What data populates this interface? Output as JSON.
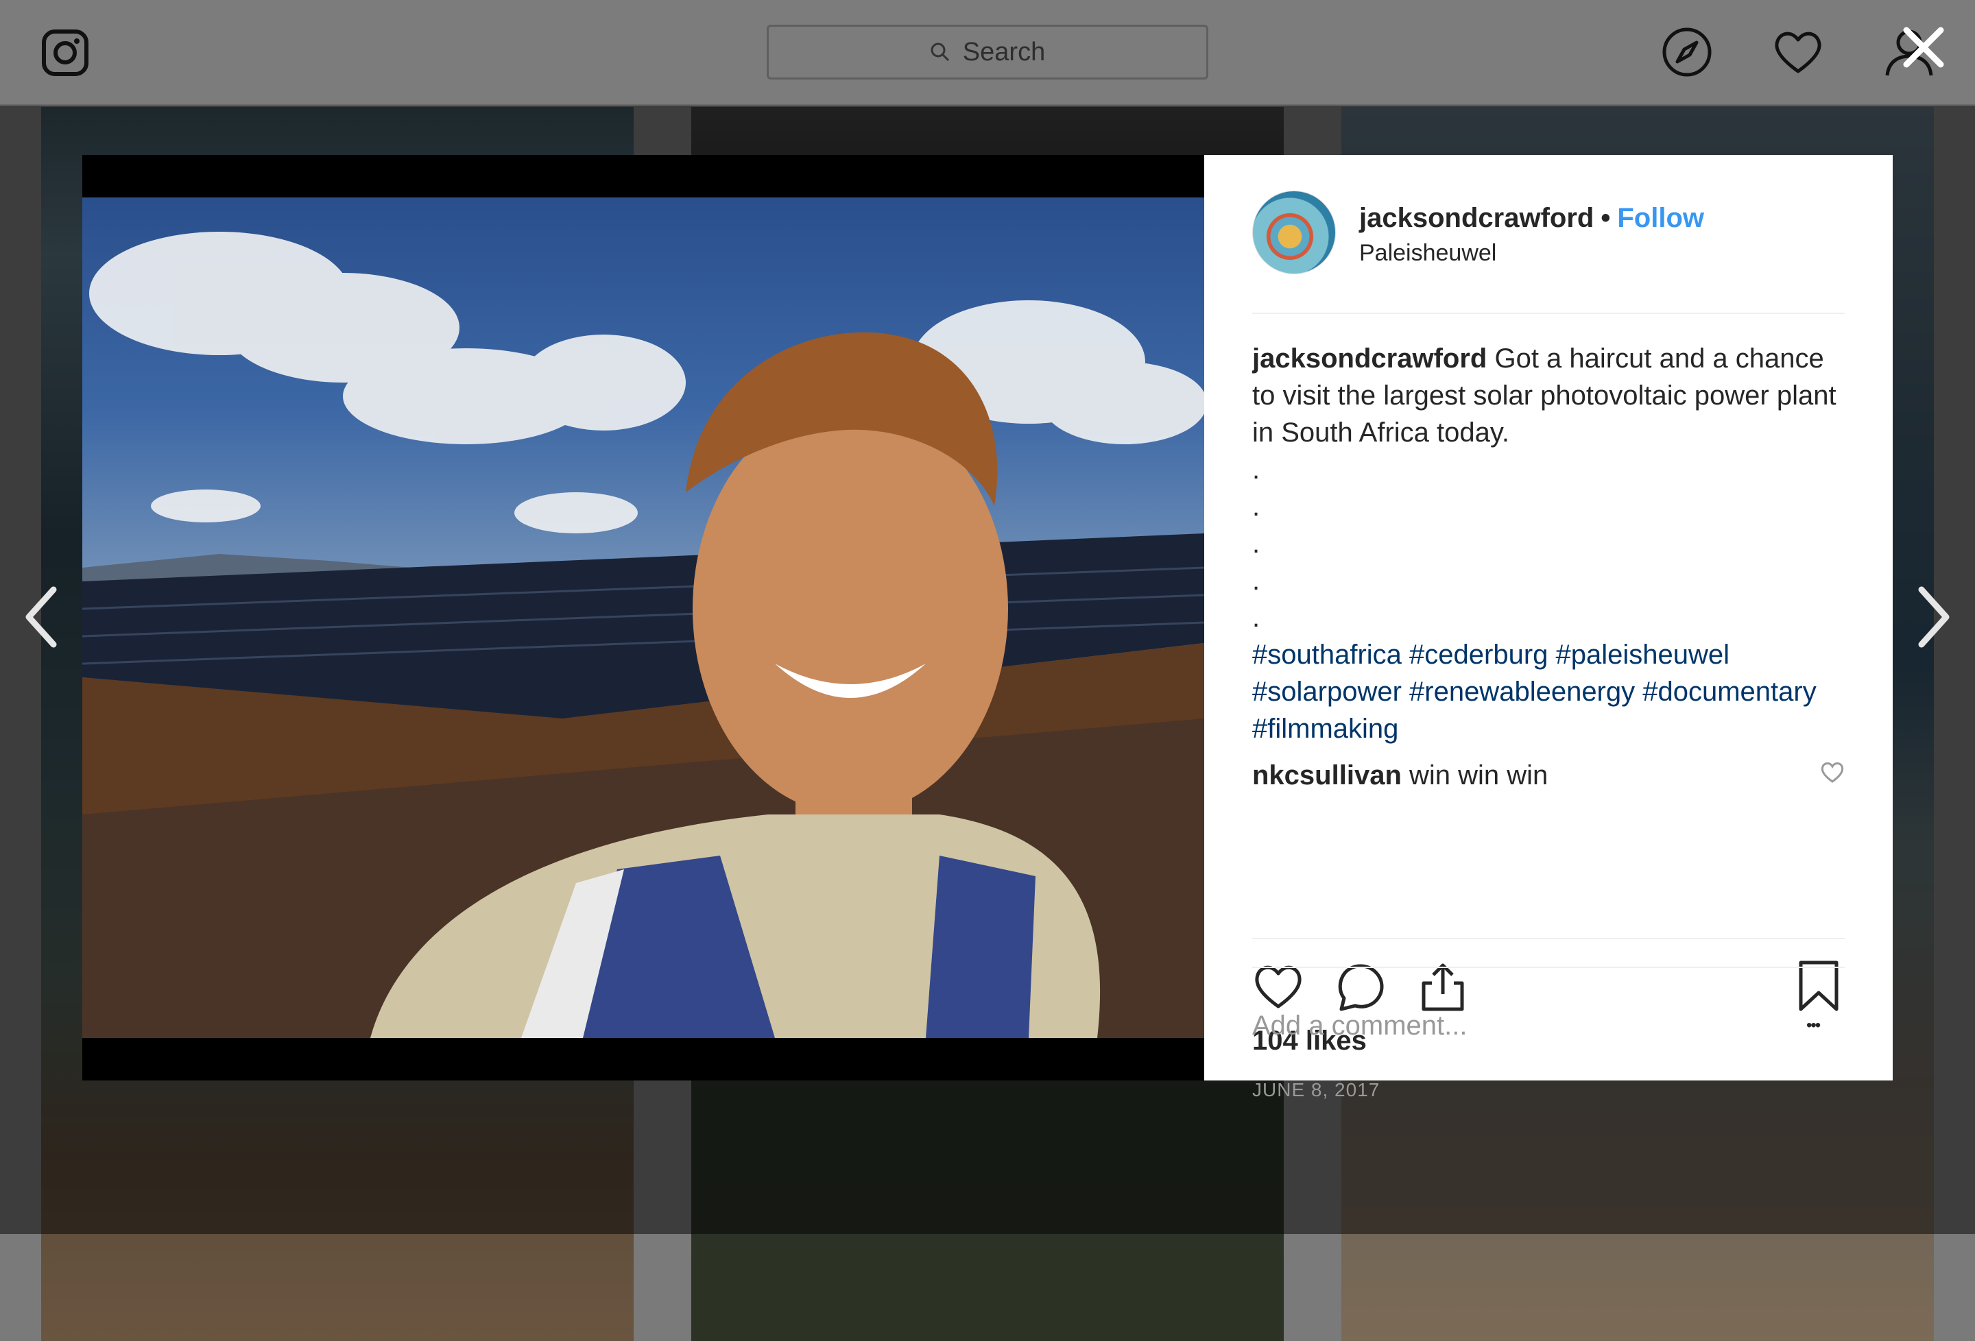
{
  "nav": {
    "search_placeholder": "Search"
  },
  "post": {
    "username": "jacksondcrawford",
    "separator": "•",
    "follow_label": "Follow",
    "location": "Paleisheuwel",
    "caption_user": "jacksondcrawford",
    "caption_text": "Got a haircut and a chance to visit the largest solar photovoltaic power plant in South Africa today.",
    "caption_dots": [
      ".",
      ".",
      ".",
      ".",
      "."
    ],
    "hashtags": "#southafrica #cederburg #paleisheuwel #solarpower #renewableenergy #documentary #filmmaking",
    "comment_user": "nkcsullivan",
    "comment_text": "win win win",
    "likes": "104 likes",
    "date": "JUNE 8, 2017",
    "add_comment_placeholder": "Add a comment...",
    "more_label": "•••"
  },
  "colors": {
    "follow": "#3897f0",
    "hashtag": "#003569",
    "text": "#262626",
    "muted": "#999999"
  },
  "icons": [
    "instagram-logo-icon",
    "search-icon",
    "compass-icon",
    "heart-icon",
    "profile-icon",
    "close-icon",
    "chevron-left-icon",
    "chevron-right-icon",
    "comment-icon",
    "share-icon",
    "bookmark-icon",
    "more-icon"
  ]
}
